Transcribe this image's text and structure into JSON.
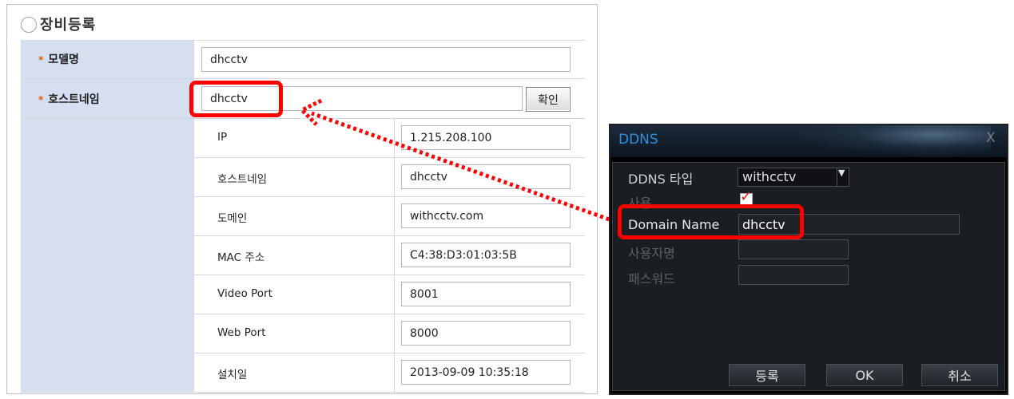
{
  "form": {
    "title": "장비등록",
    "model_label": "모델명",
    "model_value": "dhcctv",
    "host_label": "호스트네임",
    "host_value": "dhcctv",
    "confirm_label": "확인",
    "details": [
      {
        "label": "IP",
        "value": "1.215.208.100"
      },
      {
        "label": "호스트네임",
        "value": "dhcctv"
      },
      {
        "label": "도메인",
        "value": "withcctv.com"
      },
      {
        "label": "MAC 주소",
        "value": "C4:38:D3:01:03:5B"
      },
      {
        "label": "Video Port",
        "value": "8001"
      },
      {
        "label": "Web Port",
        "value": "8000"
      },
      {
        "label": "설치일",
        "value": "2013-09-09 10:35:18"
      }
    ],
    "required_mark": "*"
  },
  "dialog": {
    "title": "DDNS",
    "close_icon": "X",
    "ddns_type_label": "DDNS 타입",
    "ddns_type_value": "withcctv",
    "enable_label": "사용",
    "enable_checked": true,
    "domain_label": "Domain Name",
    "domain_value": "dhcctv",
    "username_label": "사용자명",
    "password_label": "패스워드",
    "buttons": {
      "register": "등록",
      "ok": "OK",
      "cancel": "취소"
    }
  },
  "colors": {
    "highlight": "#ff0000",
    "dialog_title": "#2f8fe0",
    "label_bg": "#d5dff0"
  }
}
